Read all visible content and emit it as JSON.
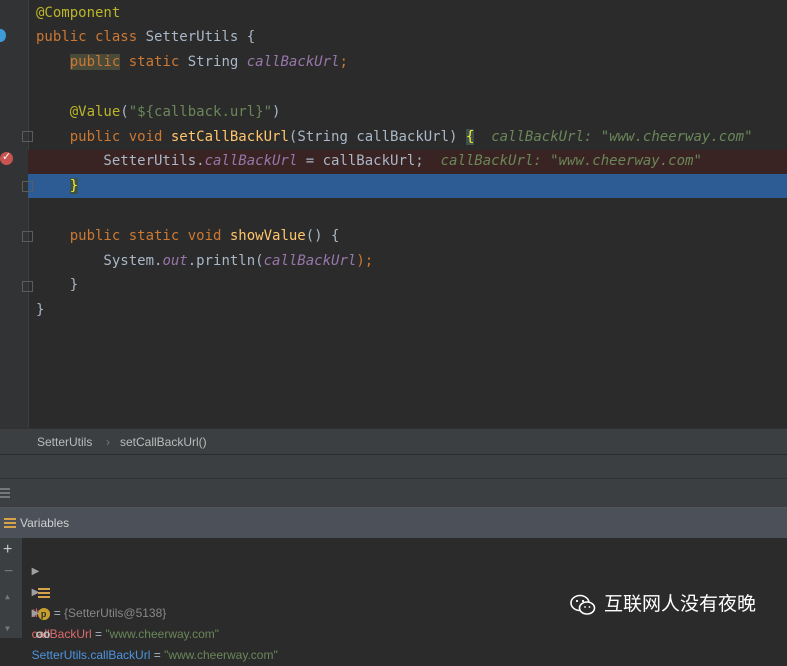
{
  "editor": {
    "lines": [
      {
        "parts": [
          {
            "t": "@Component",
            "c": "ann"
          }
        ]
      },
      {
        "parts": [
          {
            "t": "public class ",
            "c": "kw"
          },
          {
            "t": "SetterUtils {",
            "c": ""
          }
        ]
      },
      {
        "parts": [
          {
            "t": "    ",
            "c": ""
          },
          {
            "t": "public",
            "c": "kw hl-unused"
          },
          {
            "t": " static ",
            "c": "kw"
          },
          {
            "t": "String ",
            "c": ""
          },
          {
            "t": "callBackUrl",
            "c": "field"
          },
          {
            "t": ";",
            "c": "kw"
          }
        ]
      },
      {
        "parts": [
          {
            "t": "",
            "c": ""
          }
        ]
      },
      {
        "parts": [
          {
            "t": "    ",
            "c": ""
          },
          {
            "t": "@Value",
            "c": "ann"
          },
          {
            "t": "(",
            "c": ""
          },
          {
            "t": "\"${callback.url}\"",
            "c": "str"
          },
          {
            "t": ")",
            "c": ""
          }
        ]
      },
      {
        "parts": [
          {
            "t": "    ",
            "c": ""
          },
          {
            "t": "public void ",
            "c": "kw"
          },
          {
            "t": "setCallBackUrl",
            "c": "method"
          },
          {
            "t": "(String callBackUrl) ",
            "c": ""
          },
          {
            "t": "{",
            "c": "brace-hl"
          },
          {
            "t": "  callBackUrl: \"www.cheerway.com\"",
            "c": "inline-hint"
          }
        ]
      },
      {
        "parts": [
          {
            "t": "        SetterUtils.",
            "c": ""
          },
          {
            "t": "callBackUrl",
            "c": "static-field"
          },
          {
            "t": " = callBackUrl;",
            "c": ""
          },
          {
            "t": "  callBackUrl: \"www.cheerway.com\"",
            "c": "inline-hint"
          }
        ]
      },
      {
        "parts": [
          {
            "t": "    ",
            "c": ""
          },
          {
            "t": "}",
            "c": "brace-hl"
          }
        ]
      },
      {
        "parts": [
          {
            "t": "",
            "c": ""
          }
        ]
      },
      {
        "parts": [
          {
            "t": "    ",
            "c": ""
          },
          {
            "t": "public static void ",
            "c": "kw"
          },
          {
            "t": "showValue",
            "c": "method"
          },
          {
            "t": "() {",
            "c": ""
          }
        ]
      },
      {
        "parts": [
          {
            "t": "        System.",
            "c": ""
          },
          {
            "t": "out",
            "c": "static-field"
          },
          {
            "t": ".println(",
            "c": ""
          },
          {
            "t": "callBackUrl",
            "c": "static-field"
          },
          {
            "t": ");",
            "c": "kw"
          }
        ]
      },
      {
        "parts": [
          {
            "t": "    }",
            "c": ""
          }
        ]
      },
      {
        "parts": [
          {
            "t": "}",
            "c": ""
          }
        ]
      }
    ]
  },
  "breadcrumb": {
    "class_name": "SetterUtils",
    "separator": "›",
    "method_name": "setCallBackUrl()"
  },
  "variables": {
    "title": "Variables",
    "items": [
      {
        "name": "this",
        "eq": " = ",
        "value": "{SetterUtils@5138}",
        "name_color": "red",
        "icon": "list-icon"
      },
      {
        "name": "callBackUrl",
        "eq": " = ",
        "value": "\"www.cheerway.com\"",
        "name_color": "red",
        "icon": "parameter-icon"
      },
      {
        "name": "SetterUtils.callBackUrl",
        "eq": " = ",
        "value": "\"www.cheerway.com\"",
        "name_color": "blue",
        "icon": "watch-icon"
      }
    ],
    "side_add": "+",
    "side_remove": "−"
  },
  "icons": {
    "parameter_letter": "p",
    "watch_glyph": "oo"
  },
  "watermark": {
    "text": "互联网人没有夜晚"
  }
}
